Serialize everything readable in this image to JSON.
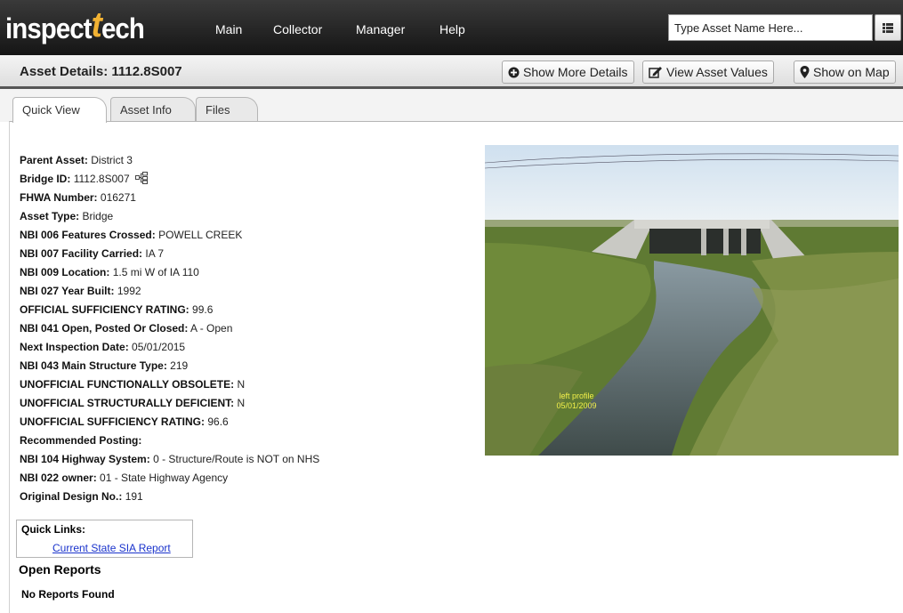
{
  "app": {
    "logo_text_a": "inspect",
    "logo_text_t": "t",
    "logo_text_b": "ech"
  },
  "nav": {
    "items": [
      {
        "label": "Main"
      },
      {
        "label": "Collector"
      },
      {
        "label": "Manager"
      },
      {
        "label": "Help"
      }
    ]
  },
  "search": {
    "placeholder": "Type Asset Name Here..."
  },
  "header": {
    "title": "Asset Details: 1112.8S007",
    "buttons": {
      "more_details": "Show More Details",
      "view_values": "View Asset Values",
      "show_map": "Show on Map"
    }
  },
  "tabs": [
    {
      "label": "Quick View",
      "active": true
    },
    {
      "label": "Asset Info",
      "active": false
    },
    {
      "label": "Files",
      "active": false
    }
  ],
  "details": [
    {
      "label": "Parent Asset:",
      "value": "District 3"
    },
    {
      "label": "Bridge ID:",
      "value": "1112.8S007"
    },
    {
      "label": "FHWA Number:",
      "value": "016271"
    },
    {
      "label": "Asset Type:",
      "value": "Bridge"
    },
    {
      "label": "NBI 006 Features Crossed:",
      "value": "POWELL CREEK"
    },
    {
      "label": "NBI 007 Facility Carried:",
      "value": "IA 7"
    },
    {
      "label": "NBI 009 Location:",
      "value": "1.5 mi W of IA 110"
    },
    {
      "label": "NBI 027 Year Built:",
      "value": "1992"
    },
    {
      "label": "OFFICIAL SUFFICIENCY RATING:",
      "value": "99.6"
    },
    {
      "label": "NBI 041 Open, Posted Or Closed:",
      "value": "A - Open"
    },
    {
      "label": "Next Inspection Date:",
      "value": "05/01/2015"
    },
    {
      "label": "NBI 043 Main Structure Type:",
      "value": "219"
    },
    {
      "label": "UNOFFICIAL FUNCTIONALLY OBSOLETE:",
      "value": "N"
    },
    {
      "label": "UNOFFICIAL STRUCTURALLY DEFICIENT:",
      "value": "N"
    },
    {
      "label": "UNOFFICIAL SUFFICIENCY RATING:",
      "value": "96.6"
    },
    {
      "label": "Recommended Posting:",
      "value": ""
    },
    {
      "label": "NBI 104 Highway System:",
      "value": "0 - Structure/Route is NOT on NHS"
    },
    {
      "label": "NBI 022 owner:",
      "value": "01 - State Highway Agency"
    },
    {
      "label": "Original Design No.:",
      "value": "191"
    }
  ],
  "quick_links": {
    "title": "Quick Links:",
    "link": "Current State SIA Report"
  },
  "reports": {
    "heading": "Open Reports",
    "empty": "No Reports Found"
  },
  "photo": {
    "caption_line1": "left profile",
    "caption_line2": "05/01/2009"
  },
  "icons": {
    "search_list": "list-icon",
    "more_details": "plus-circle-icon",
    "view_values": "edit-icon",
    "show_map": "map-marker-icon",
    "bridge_hierarchy": "hierarchy-icon"
  },
  "colors": {
    "topbar": "#1e1e1e",
    "logo_accent": "#f2b233",
    "link": "#1a33cc",
    "caption": "#f2f04a"
  }
}
